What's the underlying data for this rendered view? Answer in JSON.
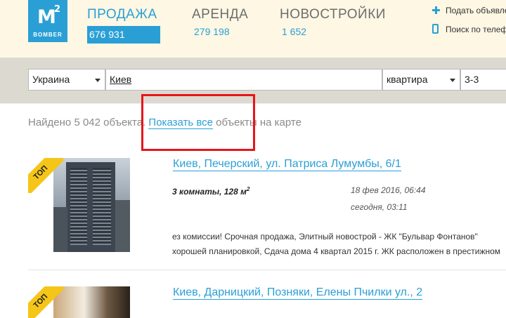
{
  "logo": {
    "mark": "M",
    "sup": "2",
    "word": "BOMBER"
  },
  "nav": [
    {
      "label": "ПРОДАЖА",
      "count": "676 931",
      "active": true
    },
    {
      "label": "АРЕНДА",
      "count": "279 198",
      "active": false
    },
    {
      "label": "НОВОСТРОЙКИ",
      "count": "1 652",
      "active": false
    }
  ],
  "header_links": {
    "add": "Подать объявление",
    "phone_search": "Поиск по телефону"
  },
  "search": {
    "country": "Украина",
    "city": "Киев",
    "type": "квартира",
    "rooms": "3-3"
  },
  "results": {
    "found_prefix": "Найдено 5 042 объекта.",
    "show_all_link": "Показать все",
    "found_suffix": "объекты на карте"
  },
  "listings": [
    {
      "badge": "ТОП",
      "address": "Киев, Печерский, ул. Патриса Лумумбы, 6/1",
      "rooms": "3 комнаты, 128 м",
      "rooms_sup": "2",
      "date_created": "18 фев 2016, 06:44",
      "date_updated": "сегодня, 03:11",
      "desc_line1": "ез комиссии! Срочная продажа, Элитный новострой - ЖК \"Бульвар Фонтанов\"",
      "desc_line2": "хорошей планировкой, Сдача дома 4 квартал 2015 г. ЖК расположен в престижном"
    },
    {
      "badge": "ТОП",
      "address": "Киев, Дарницкий, Позняки, Елены Пчилки ул., 2"
    }
  ],
  "colors": {
    "accent": "#2a9fd6",
    "header_bg": "#fdf7e4",
    "search_bg": "#dcdad0",
    "highlight": "#e8141b",
    "badge": "#f5c518"
  }
}
